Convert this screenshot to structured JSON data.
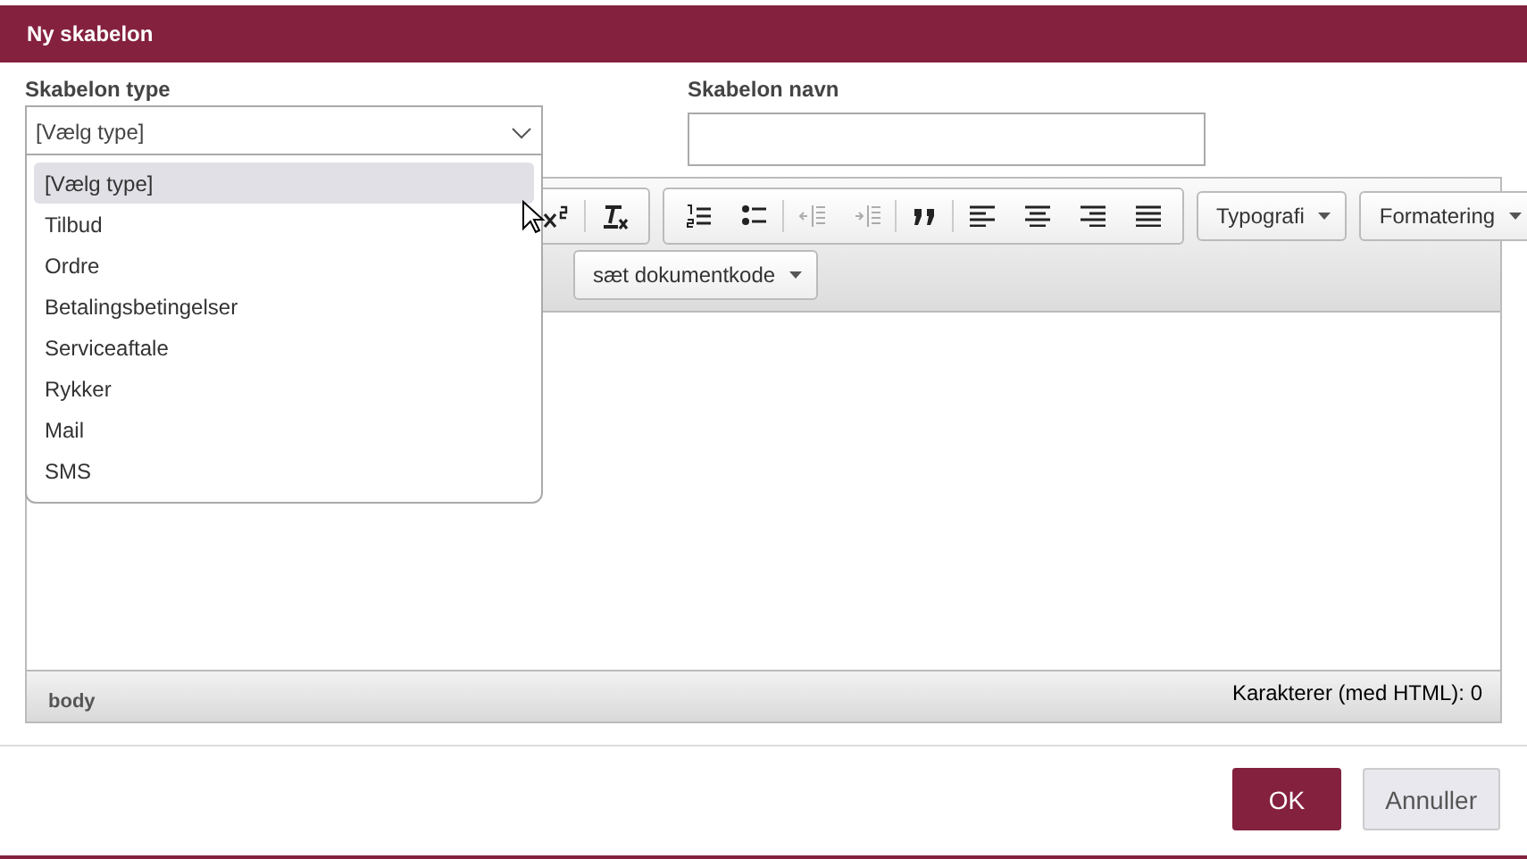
{
  "window": {
    "title": "Ny skabelon"
  },
  "type_field": {
    "label": "Skabelon type",
    "value": "[Vælg type]",
    "expanded": true,
    "options": [
      {
        "label": "[Vælg type]",
        "selected": true
      },
      {
        "label": "Tilbud",
        "selected": false
      },
      {
        "label": "Ordre",
        "selected": false
      },
      {
        "label": "Betalingsbetingelser",
        "selected": false
      },
      {
        "label": "Serviceaftale",
        "selected": false
      },
      {
        "label": "Rykker",
        "selected": false
      },
      {
        "label": "Mail",
        "selected": false
      },
      {
        "label": "SMS",
        "selected": false
      }
    ]
  },
  "name_field": {
    "label": "Skabelon navn"
  },
  "toolbar": {
    "groups": [
      [
        {
          "kind": "superscript",
          "disabled": false
        },
        {
          "kind": "clear-format",
          "disabled": false
        }
      ],
      [
        {
          "kind": "numbered-list",
          "disabled": false
        },
        {
          "kind": "bullet-list",
          "disabled": false
        },
        {
          "kind": "outdent",
          "disabled": true
        },
        {
          "kind": "indent",
          "disabled": true
        },
        {
          "kind": "quote",
          "disabled": false
        },
        {
          "kind": "align-left",
          "disabled": false
        },
        {
          "kind": "align-center",
          "disabled": false
        },
        {
          "kind": "align-right",
          "disabled": false
        },
        {
          "kind": "justify",
          "disabled": false
        }
      ]
    ],
    "menus": [
      "Typografi",
      "Formatering"
    ],
    "second_row_menus": [
      "sæt dokumentkode"
    ]
  },
  "status_bar": {
    "path": "body",
    "count": "Karakterer (med HTML): 0"
  },
  "buttons": [
    {
      "label": "OK",
      "kind": "primary"
    },
    {
      "label": "Annuller",
      "kind": "secondary"
    }
  ]
}
